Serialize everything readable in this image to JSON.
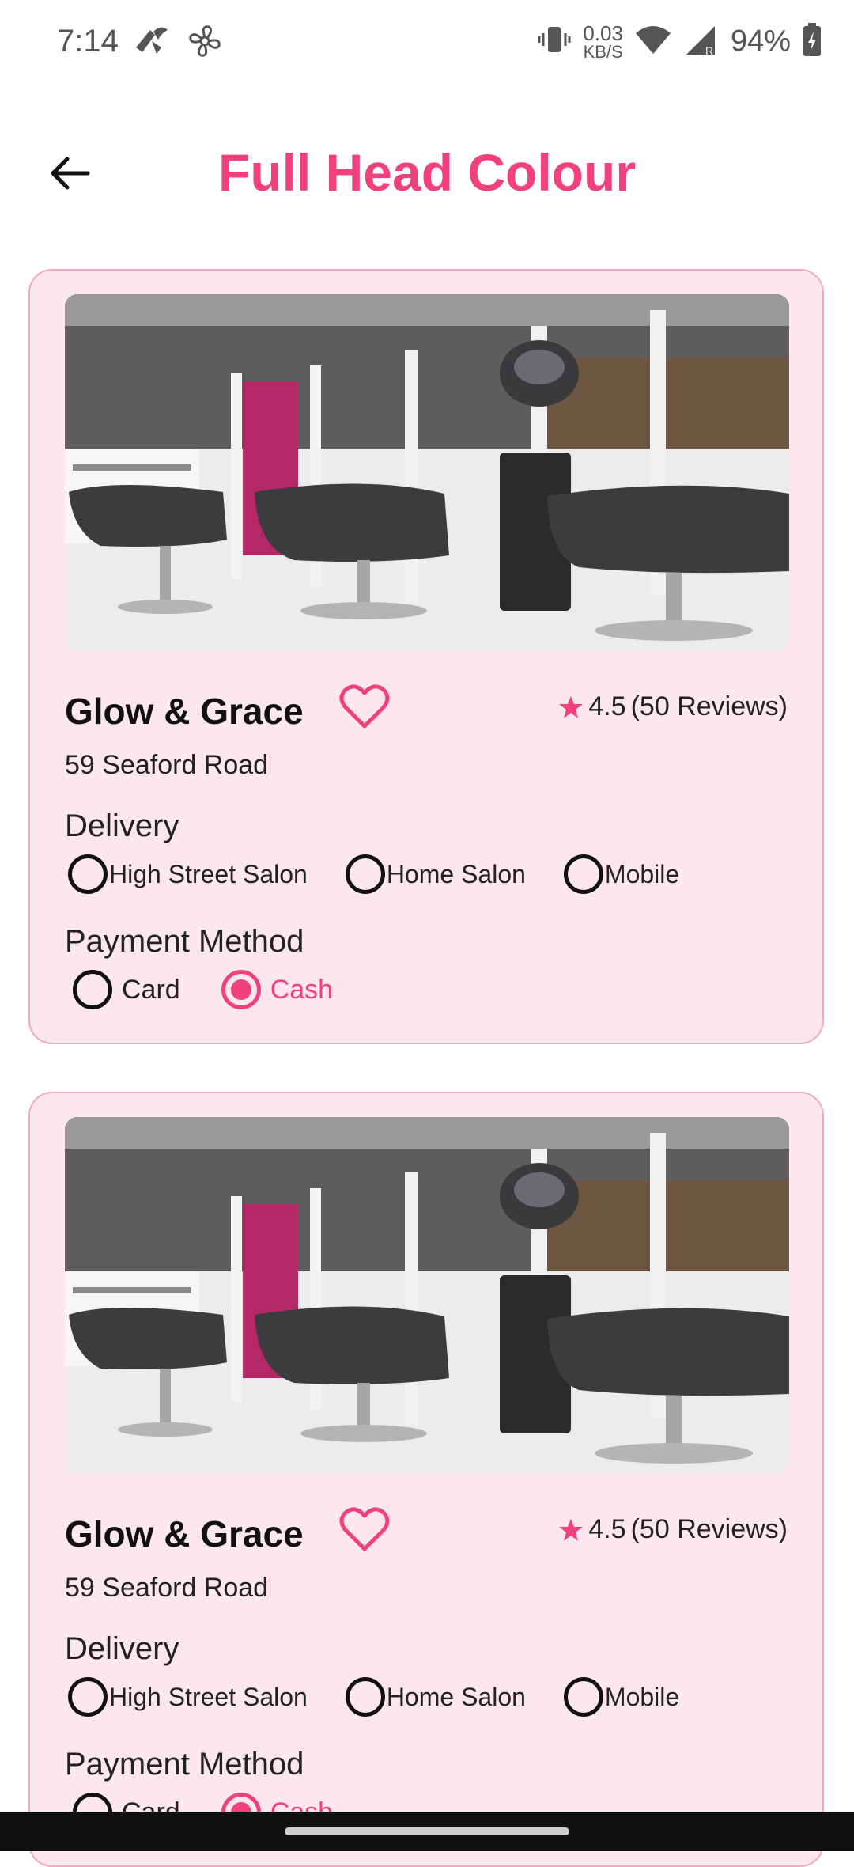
{
  "status_bar": {
    "time": "7:14",
    "net_speed_value": "0.03",
    "net_speed_unit": "KB/S",
    "battery": "94%",
    "icons": [
      "notification-icon",
      "fan-icon",
      "vibrate-icon",
      "wifi-icon",
      "signal-icon",
      "battery-icon"
    ]
  },
  "header": {
    "title": "Full Head Colour",
    "back_icon": "arrow-left-icon"
  },
  "theme": {
    "accent": "#f0407e",
    "card_background": "#fde7ef",
    "card_border": "#f3a8c2"
  },
  "salons": [
    {
      "name": "Glow & Grace",
      "address": "59 Seaford Road",
      "rating": "4.5",
      "reviews": "(50 Reviews)",
      "favorite": false,
      "delivery_label": "Delivery",
      "delivery_options": [
        "High Street Salon",
        "Home Salon",
        "Mobile"
      ],
      "payment_label": "Payment Method",
      "payment_options": [
        "Card",
        "Cash"
      ],
      "payment_selected": "Cash"
    },
    {
      "name": "Glow & Grace",
      "address": "59 Seaford Road",
      "rating": "4.5",
      "reviews": "(50 Reviews)",
      "favorite": false,
      "delivery_label": "Delivery",
      "delivery_options": [
        "High Street Salon",
        "Home Salon",
        "Mobile"
      ],
      "payment_label": "Payment Method",
      "payment_options": [
        "Card",
        "Cash"
      ],
      "payment_selected": "Cash"
    }
  ]
}
